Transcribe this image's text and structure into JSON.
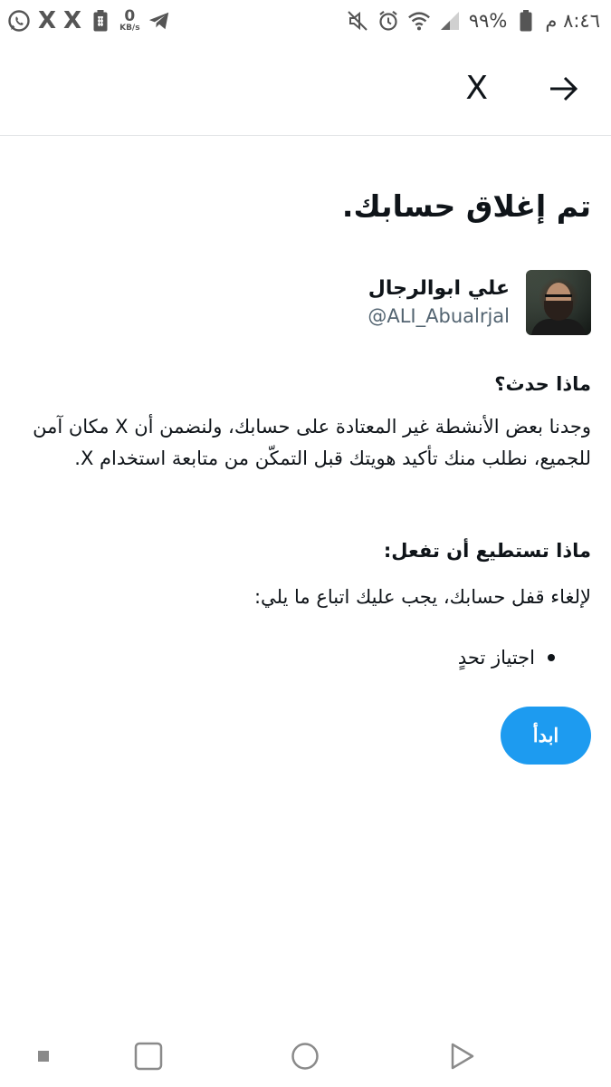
{
  "status_bar": {
    "time": "٨:٤٦ م",
    "battery": "%٩٩",
    "net_speed_value": "0",
    "net_speed_unit": "KB/s",
    "left_icons": [
      "whatsapp-icon",
      "x-app-icon",
      "x-app-icon",
      "battery-saver-icon",
      "net-speed-indicator",
      "telegram-icon"
    ],
    "right_icons": [
      "mute-icon",
      "alarm-icon",
      "wifi-icon",
      "signal-icon",
      "battery-icon"
    ]
  },
  "header": {
    "logo": "X",
    "back_icon": "arrow-right-icon"
  },
  "main": {
    "title": "تم إغلاق حسابك.",
    "user": {
      "display_name": "علي ابوالرجال",
      "handle": "@ALI_Abualrjal"
    },
    "what_happened": {
      "heading": "ماذا حدث؟",
      "body": "وجدنا بعض الأنشطة غير المعتادة على حسابك، ولنضمن أن X مكان آمن للجميع، نطلب منك تأكيد هويتك قبل التمكّن من متابعة استخدام X."
    },
    "what_you_can_do": {
      "heading": "ماذا تستطيع أن تفعل:",
      "body": "لإلغاء قفل حسابك، يجب عليك اتباع ما يلي:",
      "steps": [
        "اجتياز تحدٍ"
      ]
    },
    "start_button": "ابدأ"
  },
  "nav_bar": {
    "buttons": [
      "recents-small-icon",
      "square-icon",
      "home-circle-icon",
      "back-triangle-icon"
    ]
  },
  "colors": {
    "accent": "#1d9bf0",
    "text_primary": "#0f1419",
    "text_secondary": "#536471",
    "divider": "#e1e4e6"
  }
}
